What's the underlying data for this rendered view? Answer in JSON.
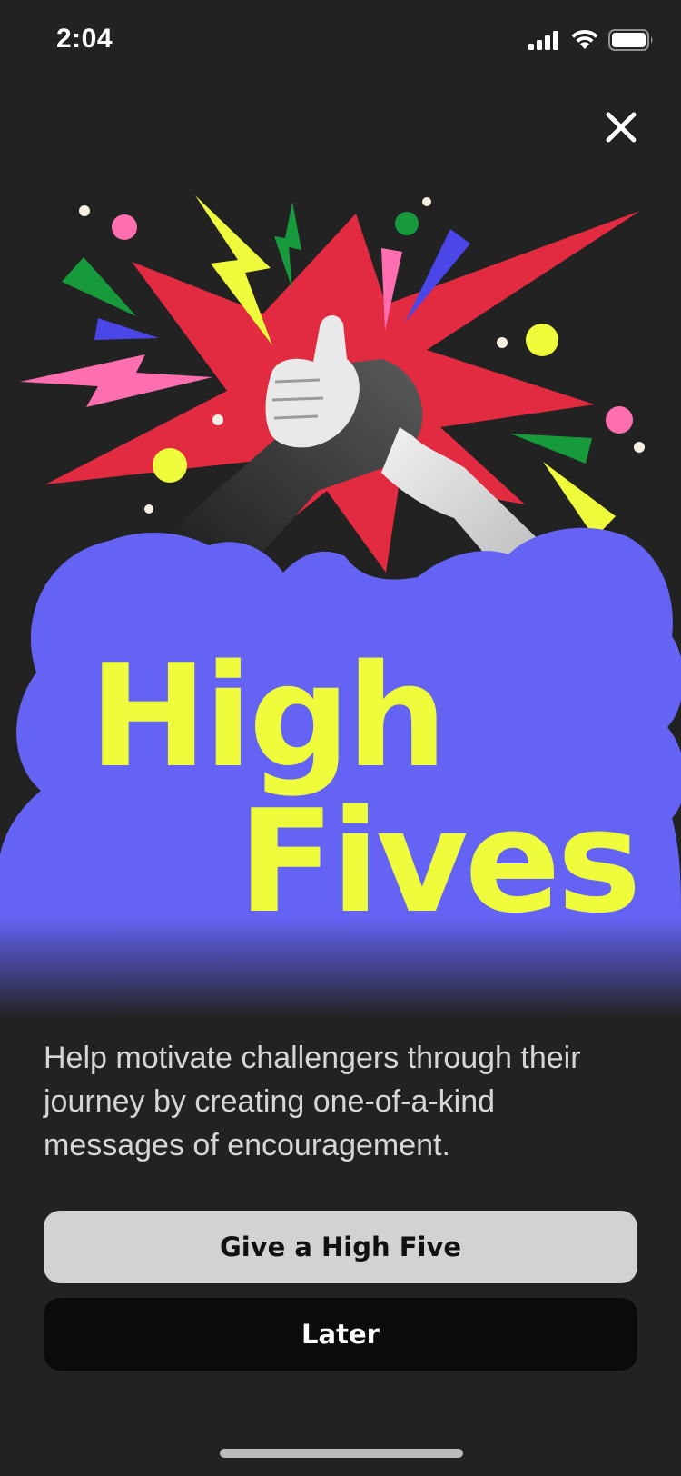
{
  "status_bar": {
    "time": "2:04",
    "icons": [
      "signal-icon",
      "wifi-icon",
      "battery-icon"
    ]
  },
  "close_icon": "close-icon",
  "hero": {
    "title_line1": "High",
    "title_line2": "Fives",
    "colors": {
      "background": "#222222",
      "cloud": "#6463f4",
      "burst": "#e22a41",
      "title": "#eefc3c",
      "yellow": "#eefc3c",
      "pink": "#ff6fb0",
      "green": "#169a3c",
      "blue": "#4a46e8"
    }
  },
  "description": "Help motivate challengers through their journey by creating one-of-a-kind messages of encouragement.",
  "buttons": {
    "primary_label": "Give a High Five",
    "secondary_label": "Later"
  }
}
